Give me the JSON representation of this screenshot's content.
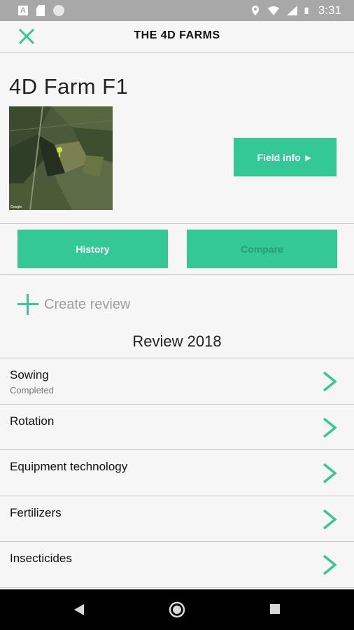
{
  "status_bar": {
    "time": "3:31",
    "left_icons": [
      "a-notification-icon",
      "sd-card-icon",
      "circle-icon"
    ],
    "right_icons": [
      "location-icon",
      "wifi-icon",
      "signal-icon",
      "battery-icon"
    ]
  },
  "app_bar": {
    "title": "THE 4D FARMS",
    "close_icon": "close-icon"
  },
  "farm": {
    "name": "4D Farm F1",
    "map_credit": "Google"
  },
  "buttons": {
    "field_info": "Field info ►",
    "history": "History",
    "compare": "Compare"
  },
  "create_review": {
    "label": "Create review"
  },
  "review": {
    "title": "Review 2018",
    "items": [
      {
        "label": "Sowing",
        "sub": "Completed"
      },
      {
        "label": "Rotation",
        "sub": ""
      },
      {
        "label": "Equipment technology",
        "sub": ""
      },
      {
        "label": "Fertilizers",
        "sub": ""
      },
      {
        "label": "Insecticides",
        "sub": ""
      }
    ]
  },
  "colors": {
    "accent": "#35c897",
    "status_bar": "#a8a8a8",
    "nav_bar": "#000000"
  }
}
